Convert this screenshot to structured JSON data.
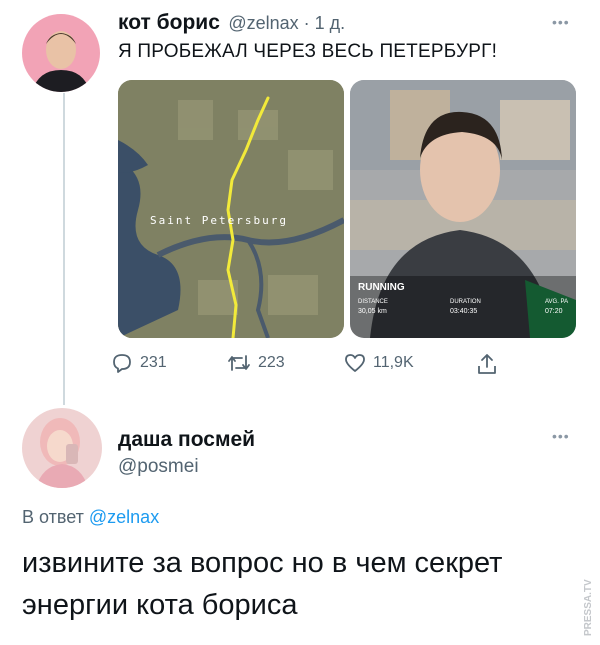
{
  "tweet1": {
    "author_name": "кот борис",
    "author_meta": "@zelnax · 1 д.",
    "text": "Я ПРОБЕЖАЛ ЧЕРЕЗ ВЕСЬ ПЕТЕРБУРГ!",
    "map_label": "Saint Petersburg",
    "run_stats": {
      "title": "RUNNING",
      "distance_label": "DISTANCE",
      "distance_value": "30,05 km",
      "duration_label": "DURATION",
      "duration_value": "03:40:35",
      "pace_label": "AVG. PA",
      "pace_value": "07:20"
    },
    "actions": {
      "replies": "231",
      "retweets": "223",
      "likes": "11,9K"
    }
  },
  "tweet2": {
    "author_name": "даша посмей",
    "author_handle": "@posmei",
    "reply_to_prefix": "В ответ ",
    "reply_to_handle": "@zelnax",
    "text_line1": "извините за вопрос но в чем секрет",
    "text_line2": "энергии кота бориса"
  },
  "watermark": "PRESSA.TV"
}
